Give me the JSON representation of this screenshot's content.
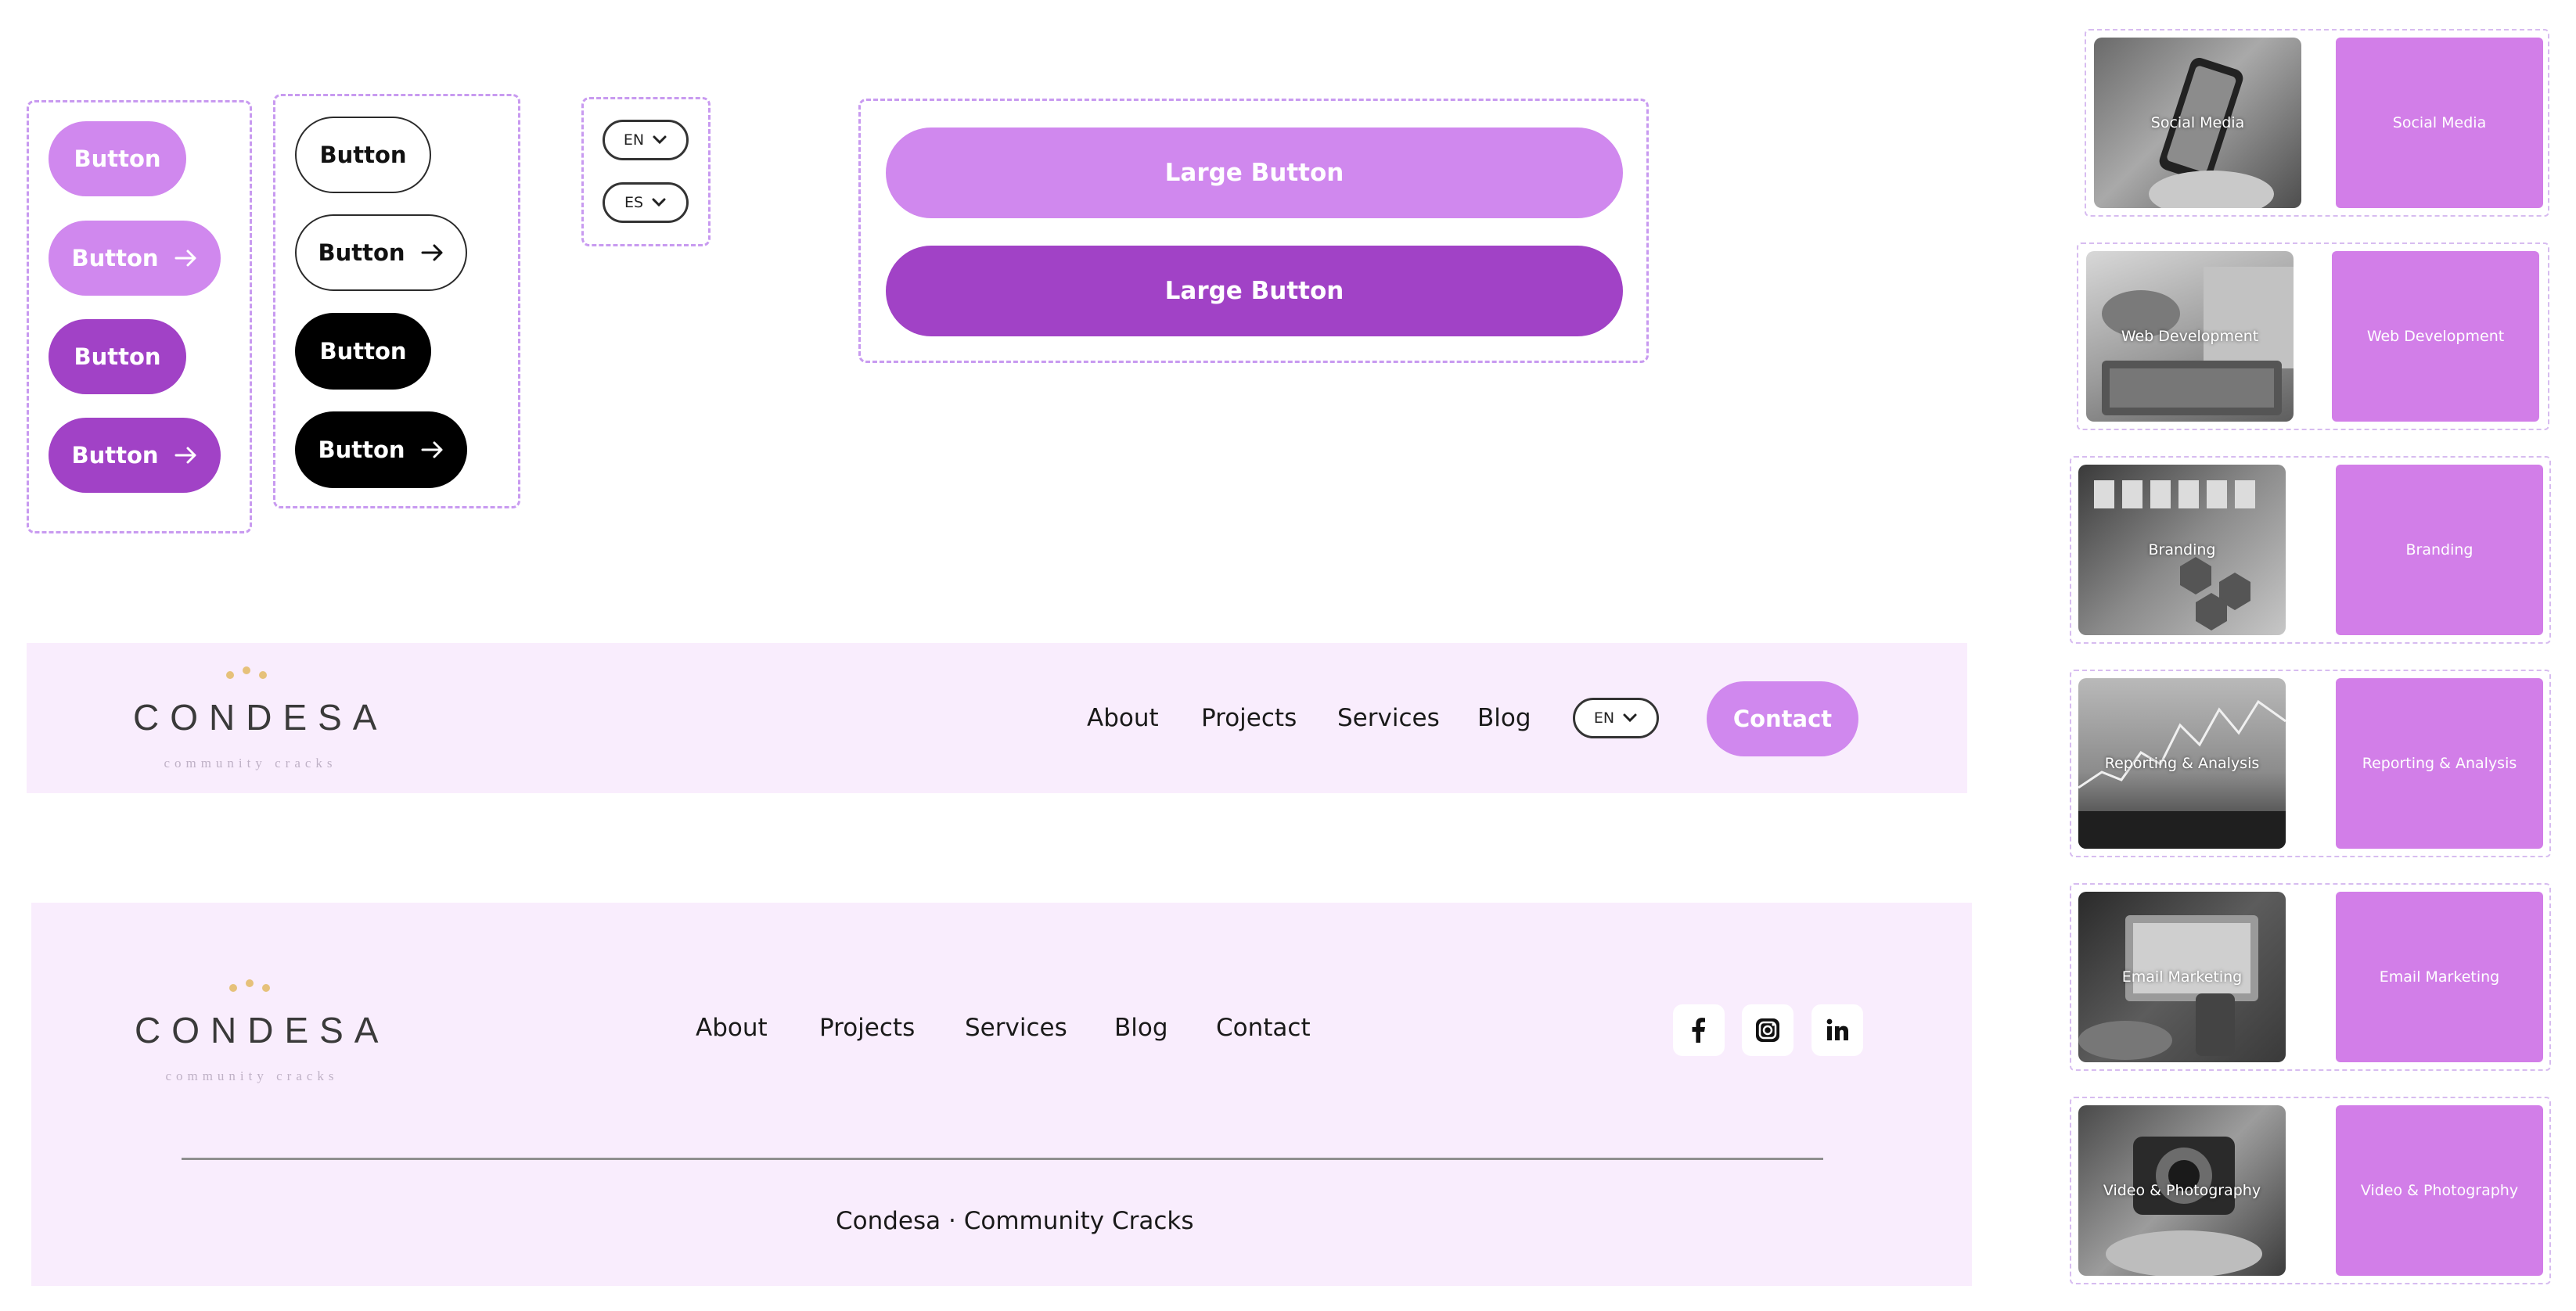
{
  "colors": {
    "light_purple": "#d088ee",
    "dark_purple": "#a142c6",
    "band_background": "#f9edfd",
    "logo_dots": "#e6c17a",
    "service_tile": "#d27ee8"
  },
  "buttons": {
    "purple_column": [
      "Button",
      "Button",
      "Button",
      "Button"
    ],
    "outline_black_column": [
      "Button",
      "Button",
      "Button",
      "Button"
    ]
  },
  "language_selectors": [
    "EN",
    "ES"
  ],
  "large_buttons": [
    "Large Button",
    "Large Button"
  ],
  "header": {
    "logo_word": "CONDESA",
    "logo_tagline": "community cracks",
    "nav": [
      "About",
      "Projects",
      "Services",
      "Blog"
    ],
    "language": "EN",
    "contact": "Contact"
  },
  "footer": {
    "logo_word": "CONDESA",
    "logo_tagline": "community cracks",
    "nav": [
      "About",
      "Projects",
      "Services",
      "Blog",
      "Contact"
    ],
    "social_icons": [
      "facebook-icon",
      "instagram-icon",
      "linkedin-icon"
    ],
    "copyright": "Condesa · Community Cracks"
  },
  "services": [
    {
      "label": "Social Media"
    },
    {
      "label": "Web Development"
    },
    {
      "label": "Branding"
    },
    {
      "label": "Reporting & Analysis"
    },
    {
      "label": "Email Marketing"
    },
    {
      "label": "Video & Photography"
    }
  ]
}
